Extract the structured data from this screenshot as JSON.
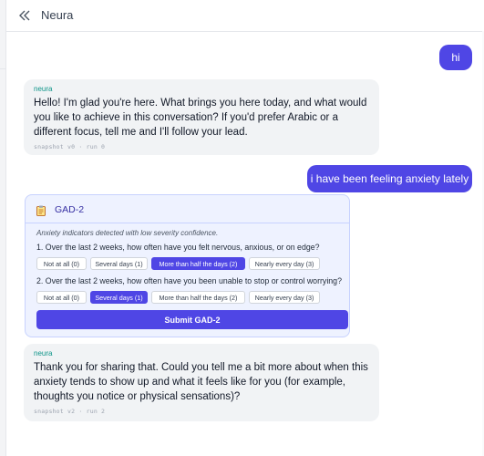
{
  "header": {
    "title": "Neura",
    "back_icon": "double-chevron-left-icon"
  },
  "messages": [
    {
      "role": "user",
      "text": "hi"
    },
    {
      "role": "assistant",
      "name": "neura",
      "text": "Hello! I'm glad you're here. What brings you here today, and what would you like to achieve in this conversation? If you'd prefer Arabic or a different focus, tell me and I'll follow your lead.",
      "meta": "snapshot v0 · run 0"
    },
    {
      "role": "user",
      "text": "i have been feeling anxiety lately"
    },
    {
      "role": "assistant",
      "name": "neura",
      "text": "Thank you for sharing that. Could you tell me a bit more about when this anxiety tends to show up and what it feels like for you (for example, thoughts you notice or physical sensations)?",
      "meta": "snapshot v2 · run 2"
    }
  ],
  "gad2": {
    "title": "GAD-2",
    "icon": "clipboard-icon",
    "note": "Anxiety indicators detected with low severity confidence.",
    "questions": [
      {
        "text": "1. Over the last 2 weeks, how often have you felt nervous, anxious, or on edge?",
        "options": [
          "Not at all (0)",
          "Several days (1)",
          "More than half the days (2)",
          "Nearly every day (3)"
        ],
        "selected": 2
      },
      {
        "text": "2. Over the last 2 weeks, how often have you been unable to stop or control worrying?",
        "options": [
          "Not at all (0)",
          "Several days (1)",
          "More than half the days (2)",
          "Nearly every day (3)"
        ],
        "selected": 1
      }
    ],
    "submit_label": "Submit GAD-2"
  },
  "colors": {
    "accent": "#4f46e5",
    "assistant_name": "#0d9488",
    "card_bg": "#eef2ff"
  }
}
